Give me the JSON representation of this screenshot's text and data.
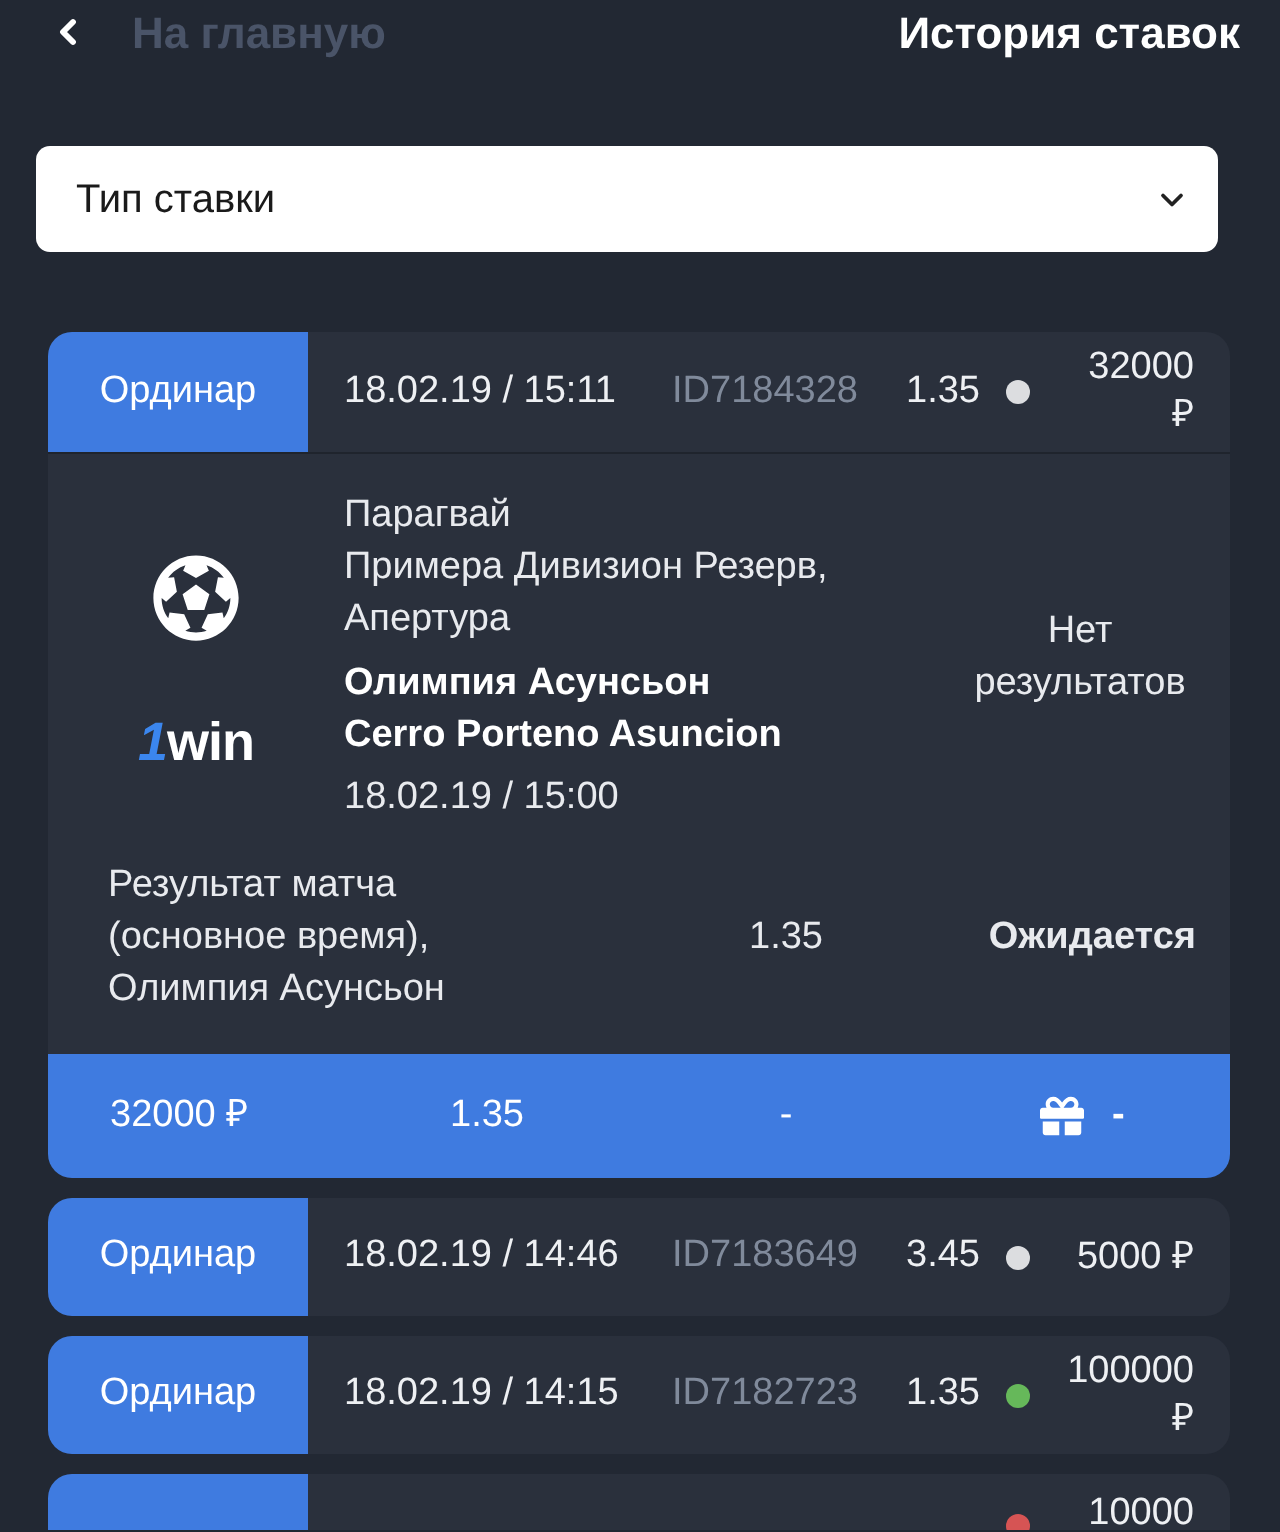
{
  "header": {
    "back_label": "На главную",
    "title": "История ставок"
  },
  "filter": {
    "label": "Тип ставки"
  },
  "bets": [
    {
      "type": "Ординар",
      "datetime": "18.02.19 / 15:11",
      "id": "ID7184328",
      "odds": "1.35",
      "color": "#dcdde0",
      "amount": "32000 ₽",
      "expanded": true,
      "details": {
        "logo": {
          "mark": "1",
          "name": "win"
        },
        "category": "Парагвай",
        "league": "Примера Дивизион Резерв, Апертура",
        "teams": [
          "Олимпия Асунсьон",
          "Cerro Porteno Asuncion"
        ],
        "start": "18.02.19 / 15:00",
        "result": "Нет результатов",
        "selection": {
          "market": "Результат матча (основное время), Олимпия Асунсьон",
          "odds": "1.35",
          "status": "Ожидается"
        },
        "summary": {
          "stake": "32000 ₽",
          "odds": "1.35",
          "payout": "-",
          "bonus": "-"
        }
      }
    },
    {
      "type": "Ординар",
      "datetime": "18.02.19 / 14:46",
      "id": "ID7183649",
      "odds": "3.45",
      "color": "#dcdde0",
      "amount": "5000 ₽",
      "expanded": false
    },
    {
      "type": "Ординар",
      "datetime": "18.02.19 / 14:15",
      "id": "ID7182723",
      "odds": "1.35",
      "color": "#66b85a",
      "amount": "100000 ₽",
      "expanded": false
    },
    {
      "color": "#d65454",
      "amount": "10000",
      "expanded": false,
      "cut_off": true
    }
  ]
}
